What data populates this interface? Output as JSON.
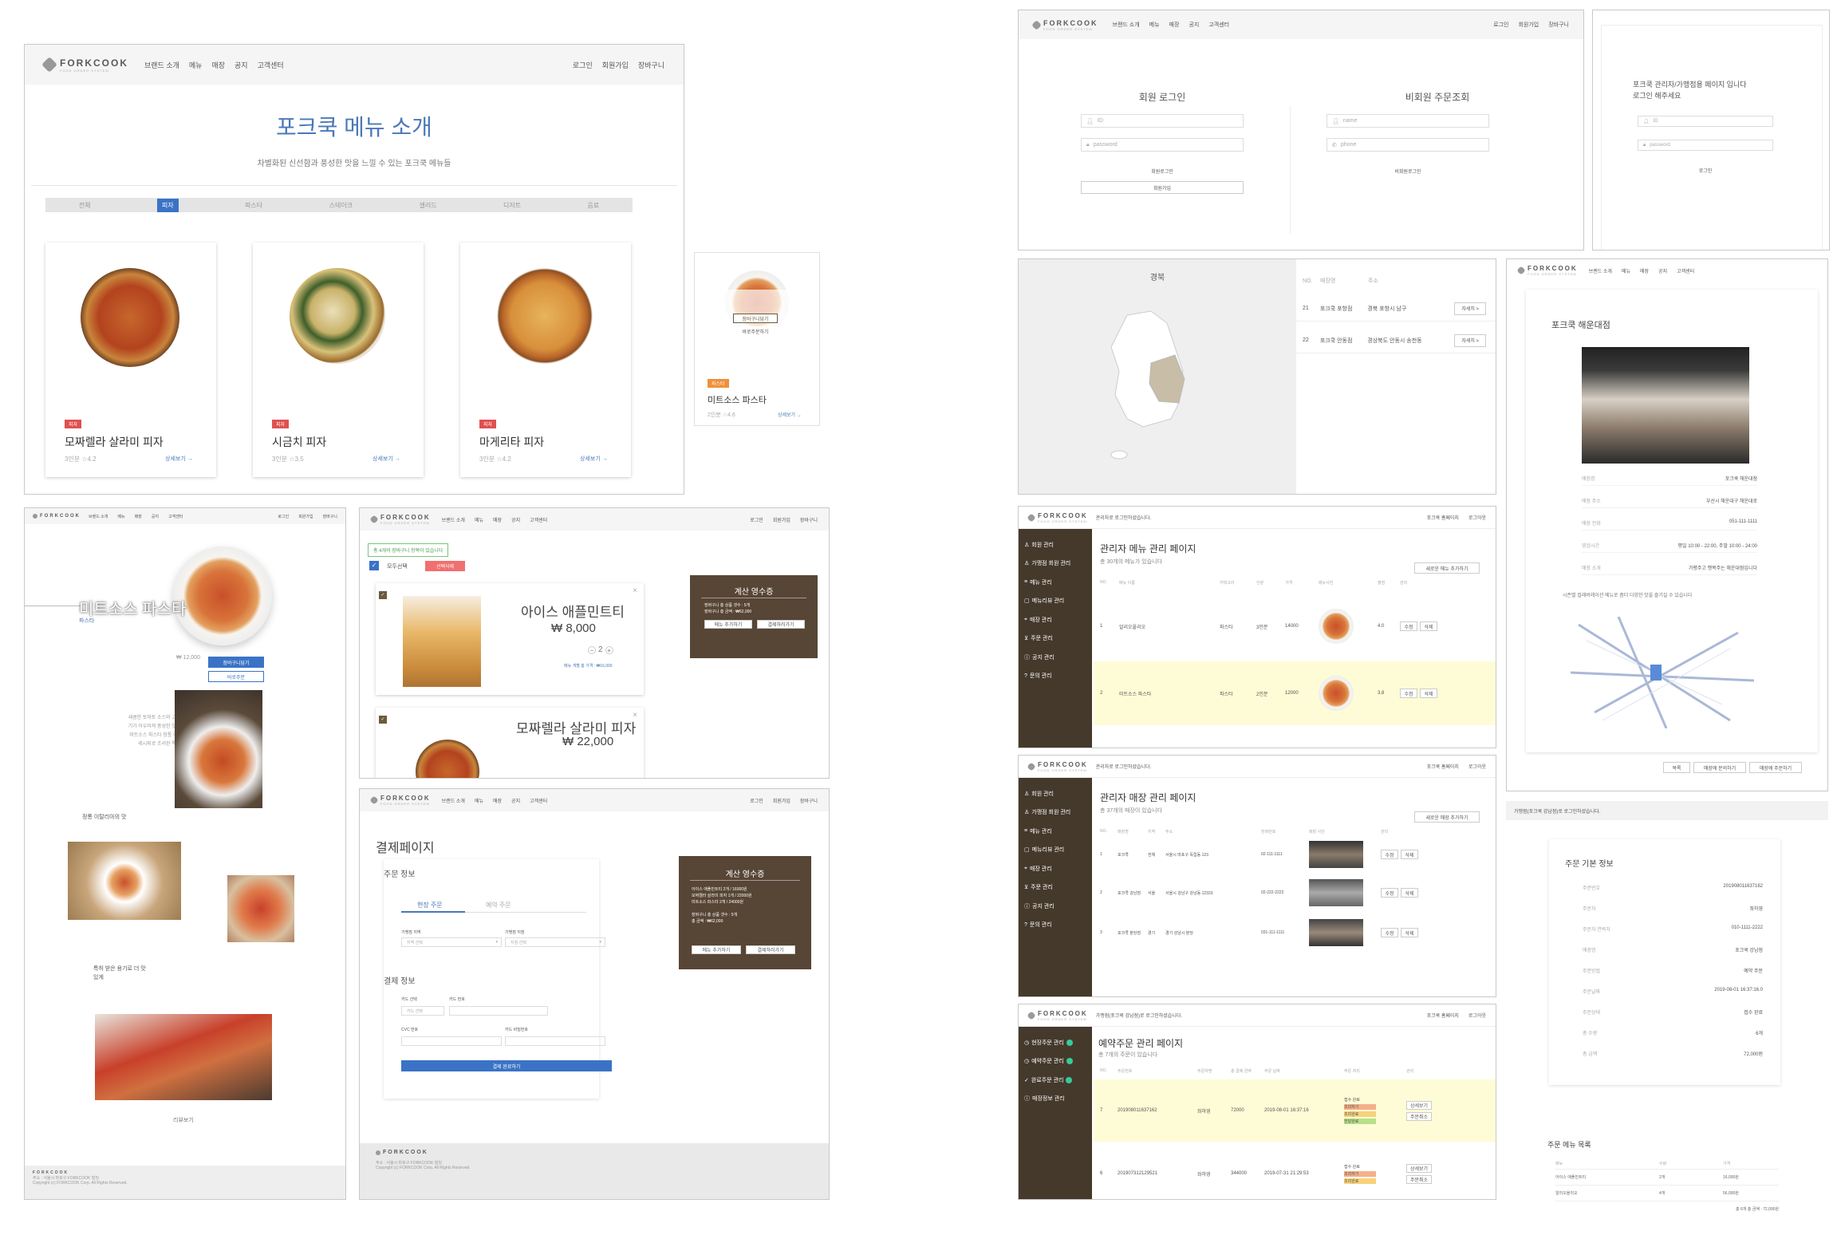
{
  "brand": {
    "name": "FORKCOOK",
    "sub": "FOOD ORDER SYSTEM"
  },
  "nav": {
    "menu": [
      "브랜드 소개",
      "메뉴",
      "매장",
      "공지",
      "고객센터"
    ],
    "right": [
      "로그인",
      "회원가입",
      "장바구니"
    ]
  },
  "menu_intro": {
    "title": "포크쿡 메뉴 소개",
    "subtitle": "차별화된 신선함과 풍성한 맛을 느낄 수 있는 포크쿡 메뉴들",
    "tabs": [
      "전체",
      "피자",
      "파스타",
      "스테이크",
      "샐러드",
      "디저트",
      "음료"
    ],
    "active_tab": "피자",
    "cards": [
      {
        "tag": "피자",
        "name": "모짜렐라 살라미 피자",
        "meta": "3인분 ☆4.2",
        "link": "상세보기 →"
      },
      {
        "tag": "피자",
        "name": "시금치 피자",
        "meta": "3인분 ☆3.5",
        "link": "상세보기 →"
      },
      {
        "tag": "피자",
        "name": "마게리타 피자",
        "meta": "3인분 ☆4.2",
        "link": "상세보기 →"
      }
    ]
  },
  "small_card": {
    "tag": "파스타",
    "name": "미트소스 파스타",
    "meta": "2인분 ☆4.6",
    "link": "상세보기 →",
    "btn1": "장바구니담기",
    "btn2": "바로주문하기"
  },
  "detail": {
    "title": "미트소스 파스타",
    "cat": "파스타",
    "price": "₩ 12,000",
    "buttons": [
      "장바구니담기",
      "바로주문"
    ],
    "desc": "새콤한 토마토 소스와 고소한 고기가 어우러져 풍성한 맛을 내는 미트소스 파스타 정통 이탈리안 레시피로 조리한 특별한 맛",
    "sub1": "정통 이탈리아의 맛",
    "sub2": "특허 받은 용기로 더 맛있게",
    "more": "리뷰보기"
  },
  "cart": {
    "notice": "총 4개의 장바구니 항목이 있습니다",
    "select_all": "모두선택",
    "delete": "선택삭제",
    "items": [
      {
        "name": "아이스 애플민트티",
        "price": "₩ 8,000",
        "qty": "2",
        "sum": "메뉴 개별 총 가격 : ₩16,000"
      },
      {
        "name": "모짜렐라 살라미 피자",
        "price": "₩ 22,000"
      }
    ],
    "receipt": {
      "title": "계산 영수증",
      "lines": [
        "장바구니 총 상품 갯수 : 5개",
        "장바구니 총 금액 : ₩62,000"
      ],
      "btn1": "메뉴 추가하기",
      "btn2": "결제하러가기"
    }
  },
  "payment": {
    "title": "결제페이지",
    "order_info": "주문 정보",
    "tabs": [
      "현장 주문",
      "예약 주문"
    ],
    "f1": "가맹점 지역",
    "f2": "가맹점 지점",
    "sel1": "지역 선택",
    "sel2": "지점 선택",
    "pay_info": "결제 정보",
    "card_type": "카드 선택",
    "card_no": "카드 번호",
    "cvc": "CVC 번호",
    "pw": "카드 비밀번호",
    "pay_btn": "결제 완료하기",
    "receipt": {
      "title": "계산 영수증",
      "lines": [
        "아이스 애플민트티 2개 / 16000원",
        "모짜렐라 살라미 피자 1개 / 22000원",
        "미트소스 파스타 2개 / 24000원"
      ],
      "total": [
        "장바구니 총 상품 갯수 : 5개",
        "총 금액 : ₩62,000"
      ],
      "btn1": "메뉴 추가하기",
      "btn2": "결제하러가기"
    },
    "footer": [
      "주소 : 서울시 마포구 FORKCOOK 빌딩",
      "Copyright (c) FORKCOOK Corp. All Rights Reserved."
    ]
  },
  "login": {
    "member": "회원 로그인",
    "guest": "비회원 주문조회",
    "id": "ID",
    "pw": "password",
    "name": "name",
    "phone": "phone",
    "login_btn": "회원로그인",
    "join_btn": "회원가입",
    "guest_btn": "비회원로그인"
  },
  "admin_login": {
    "msg1": "포크쿡 관리자/가맹점용 페이지 입니다",
    "msg2": "로그인 해주세요",
    "id": "ID",
    "pw": "password",
    "btn": "로그인"
  },
  "map": {
    "region": "경북",
    "cols": [
      "NO.",
      "매장명",
      "주소"
    ],
    "rows": [
      {
        "no": "21",
        "name": "포크쿡 포항점",
        "addr": "경북 포항시 남구",
        "btn": "자세히 >"
      },
      {
        "no": "22",
        "name": "포크쿡 안동점",
        "addr": "경상북도 안동시 송천동",
        "btn": "자세히 >"
      }
    ]
  },
  "store": {
    "title": "포크쿡 해운대점",
    "rows": [
      [
        "매장명",
        "포크쿡 해운대점"
      ],
      [
        "매장 주소",
        "부산시 해운대구 해운대로"
      ],
      [
        "매장 전화",
        "051-111-1111"
      ],
      [
        "영업시간",
        "평일 10:00 - 22:00, 주말 10:00 - 24:00"
      ],
      [
        "매장 소개",
        "가평주고 행복주는 해운대점입니다"
      ]
    ],
    "desc": "시즌별 컬래버레이션 메뉴로 좀더 다양한 맛을 즐기실 수 있습니다",
    "buttons": [
      "목록",
      "매장에 문의하기",
      "매장에 주문하기"
    ]
  },
  "admin_menu": {
    "welcome": "관리자로 로그인하셨습니다.",
    "right": [
      "포크쿡 홈페이지",
      "로그아웃"
    ],
    "title": "관리자 메뉴 관리 페이지",
    "count": "총 30개의 메뉴가 있습니다",
    "add": "새로운 메뉴 추가하기",
    "cols": [
      "NO.",
      "메뉴 이름",
      "카테고리",
      "인분",
      "가격",
      "메뉴사진",
      "평점",
      "관리"
    ],
    "rows": [
      [
        "1",
        "알리오올리오",
        "파스타",
        "3인분",
        "14000",
        "4.0"
      ],
      [
        "2",
        "미트소스 파스타",
        "파스타",
        "2인분",
        "12000",
        "3.8"
      ]
    ],
    "edit": "수정",
    "del": "삭제",
    "side": [
      "회원 관리",
      "가맹점 회원 관리",
      "메뉴 관리",
      "메뉴리뷰 관리",
      "매장 관리",
      "주문 관리",
      "공지 관리",
      "문의 관리"
    ]
  },
  "admin_store": {
    "title": "관리자 매장 관리 페이지",
    "count": "총 37개의 매장이 있습니다",
    "add": "새로운 매장 추가하기",
    "cols": [
      "NO.",
      "매장명",
      "지역",
      "주소",
      "전화번호",
      "매장 사진",
      "관리"
    ],
    "rows": [
      [
        "1",
        "포크쿡",
        "전체",
        "서울시 마포구 독립동 123",
        "02-111-1111"
      ],
      [
        "2",
        "포크쿡 강남점",
        "서울",
        "서울시 강남구 강남동 12333",
        "02-222-2222"
      ],
      [
        "3",
        "포크쿡 분당점",
        "경기",
        "경기 성남시 분당",
        "031-111-1111"
      ]
    ]
  },
  "admin_order": {
    "welcome": "가맹점(포크쿡 강남점)로 로그인하셨습니다.",
    "title": "예약주문 관리 페이지",
    "count": "총 7개의 주문이 있습니다",
    "cols": [
      "NO.",
      "주문번호",
      "주문자명",
      "총 결제 금액",
      "주문 날짜",
      "주문 처리",
      "관리"
    ],
    "side": [
      "현장주문 관리",
      "예약주문 관리",
      "완료주문 관리",
      "매장정보 관리"
    ],
    "rows": [
      [
        "7",
        "20190801163716​2",
        "좌하영",
        "72000",
        "2019-08-01 16:37:16"
      ],
      [
        "6",
        "20190731212952​1",
        "좌하영",
        "344000",
        "2019-07-31 21:29:53"
      ]
    ],
    "status": "접수 완료",
    "s1": "조리하기",
    "s2": "조리완료",
    "s3": "전달완료",
    "b1": "상세보기",
    "b2": "주문취소"
  },
  "order_info": {
    "banner": "가맹점(포크쿡 강남점)로 로그인하셨습니다.",
    "title": "주문 기본 정보",
    "rows": [
      [
        "주문번호",
        "20190801163716​2"
      ],
      [
        "주문자",
        "좌하영"
      ],
      [
        "주문자 연락처",
        "010-1111-2222"
      ],
      [
        "매장명",
        "포크쿡 강남점"
      ],
      [
        "주문방법",
        "예약 주문"
      ],
      [
        "주문날짜",
        "2019-08-01 16:37:16.0"
      ],
      [
        "주문상태",
        "접수 완료"
      ],
      [
        "총 수량",
        "6개"
      ],
      [
        "총 금액",
        "72,000원"
      ]
    ],
    "list_title": "주문 메뉴 목록",
    "list_cols": [
      "메뉴",
      "수량",
      "가격"
    ],
    "list_rows": [
      [
        "아이스 애플민트티",
        "2개",
        "16,000원"
      ],
      [
        "알리오올리오",
        "4개",
        "56,000원"
      ]
    ],
    "list_total": "총 6개   총 금액 : 72,000원"
  }
}
